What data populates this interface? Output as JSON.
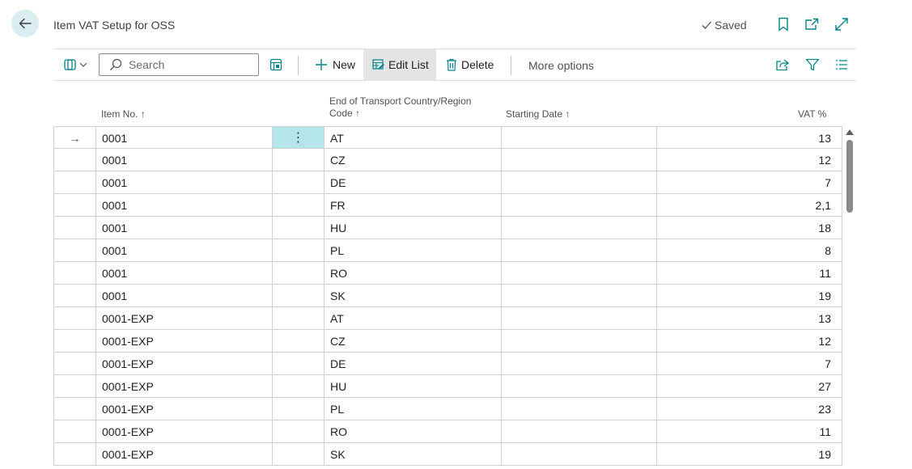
{
  "header": {
    "title": "Item VAT Setup for OSS",
    "saved_label": "Saved"
  },
  "toolbar": {
    "search_placeholder": "Search",
    "new_label": "New",
    "edit_list_label": "Edit List",
    "delete_label": "Delete",
    "more_options_label": "More options"
  },
  "table": {
    "columns": {
      "item_no": "Item No.",
      "country_line1": "End of Transport Country/Region",
      "country_line2": "Code",
      "starting_date": "Starting Date",
      "vat": "VAT %"
    },
    "sort_glyph": "↑",
    "current_row_glyph": "→",
    "row_menu_glyph": "⋮",
    "rows": [
      {
        "item_no": "0001",
        "country": "AT",
        "starting_date": "",
        "vat": "13"
      },
      {
        "item_no": "0001",
        "country": "CZ",
        "starting_date": "",
        "vat": "12"
      },
      {
        "item_no": "0001",
        "country": "DE",
        "starting_date": "",
        "vat": "7"
      },
      {
        "item_no": "0001",
        "country": "FR",
        "starting_date": "",
        "vat": "2,1"
      },
      {
        "item_no": "0001",
        "country": "HU",
        "starting_date": "",
        "vat": "18"
      },
      {
        "item_no": "0001",
        "country": "PL",
        "starting_date": "",
        "vat": "8"
      },
      {
        "item_no": "0001",
        "country": "RO",
        "starting_date": "",
        "vat": "11"
      },
      {
        "item_no": "0001",
        "country": "SK",
        "starting_date": "",
        "vat": "19"
      },
      {
        "item_no": "0001-EXP",
        "country": "AT",
        "starting_date": "",
        "vat": "13"
      },
      {
        "item_no": "0001-EXP",
        "country": "CZ",
        "starting_date": "",
        "vat": "12"
      },
      {
        "item_no": "0001-EXP",
        "country": "DE",
        "starting_date": "",
        "vat": "7"
      },
      {
        "item_no": "0001-EXP",
        "country": "HU",
        "starting_date": "",
        "vat": "27"
      },
      {
        "item_no": "0001-EXP",
        "country": "PL",
        "starting_date": "",
        "vat": "23"
      },
      {
        "item_no": "0001-EXP",
        "country": "RO",
        "starting_date": "",
        "vat": "11"
      },
      {
        "item_no": "0001-EXP",
        "country": "SK",
        "starting_date": "",
        "vat": "19"
      }
    ]
  },
  "colors": {
    "accent": "#008489",
    "back_button_bg": "#daeef2",
    "selected_cell_bg": "#b3e5ea"
  }
}
